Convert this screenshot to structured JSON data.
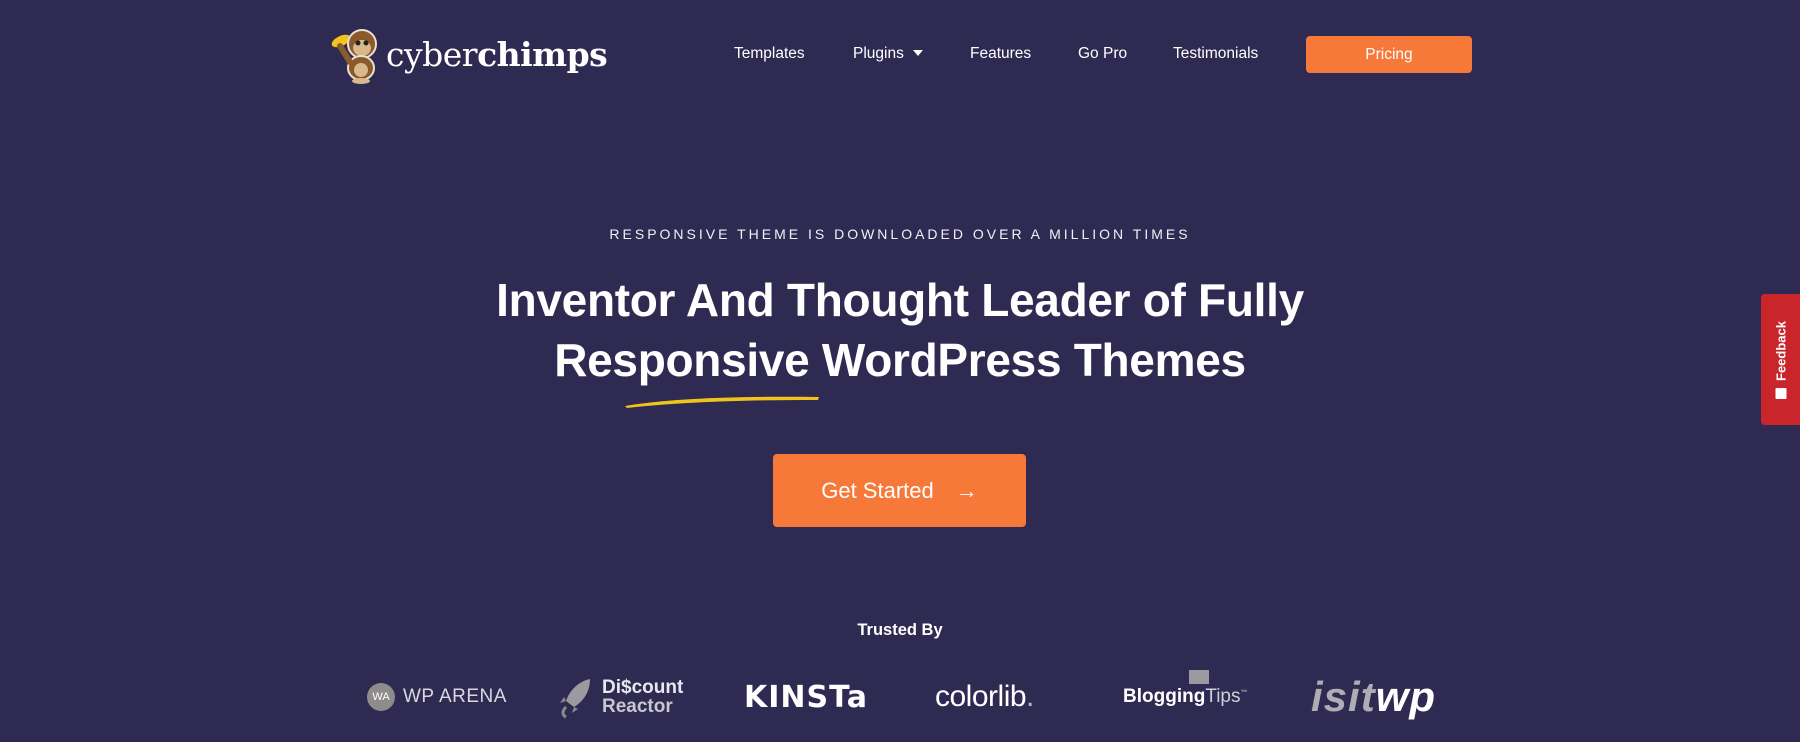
{
  "header": {
    "logo": {
      "text_light": "cyber",
      "text_bold": "chimps",
      "icon": "chimp-mascot-icon"
    },
    "nav": [
      {
        "label": "Templates"
      },
      {
        "label": "Plugins",
        "has_dropdown": true
      },
      {
        "label": "Features"
      },
      {
        "label": "Go Pro"
      },
      {
        "label": "Testimonials"
      }
    ],
    "pricing_label": "Pricing"
  },
  "hero": {
    "eyebrow": "RESPONSIVE THEME IS DOWNLOADED OVER A MILLION TIMES",
    "headline_line1": "Inventor And Thought Leader of Fully",
    "headline_line2": "Responsive WordPress Themes",
    "cta_label": "Get Started",
    "cta_arrow": "→"
  },
  "trusted": {
    "title": "Trusted By",
    "brands": {
      "wp_arena": {
        "badge": "WA",
        "name": "WP ARENA"
      },
      "discount_reactor": {
        "line1": "Di$count",
        "line2": "Reactor"
      },
      "kinsta": {
        "name": "KINSTa"
      },
      "colorlib": {
        "name": "colorlib",
        "dot": "."
      },
      "blogging_tips": {
        "name_bold": "Blogging",
        "name_light": "Tips",
        "tm": "™"
      },
      "isitwp": {
        "part1": "isit",
        "part2": "wp"
      }
    }
  },
  "feedback": {
    "label": "Feedback"
  },
  "colors": {
    "background": "#2e2a52",
    "accent": "#f7793a",
    "feedback": "#c9252b",
    "underline": "#f2c31a"
  }
}
